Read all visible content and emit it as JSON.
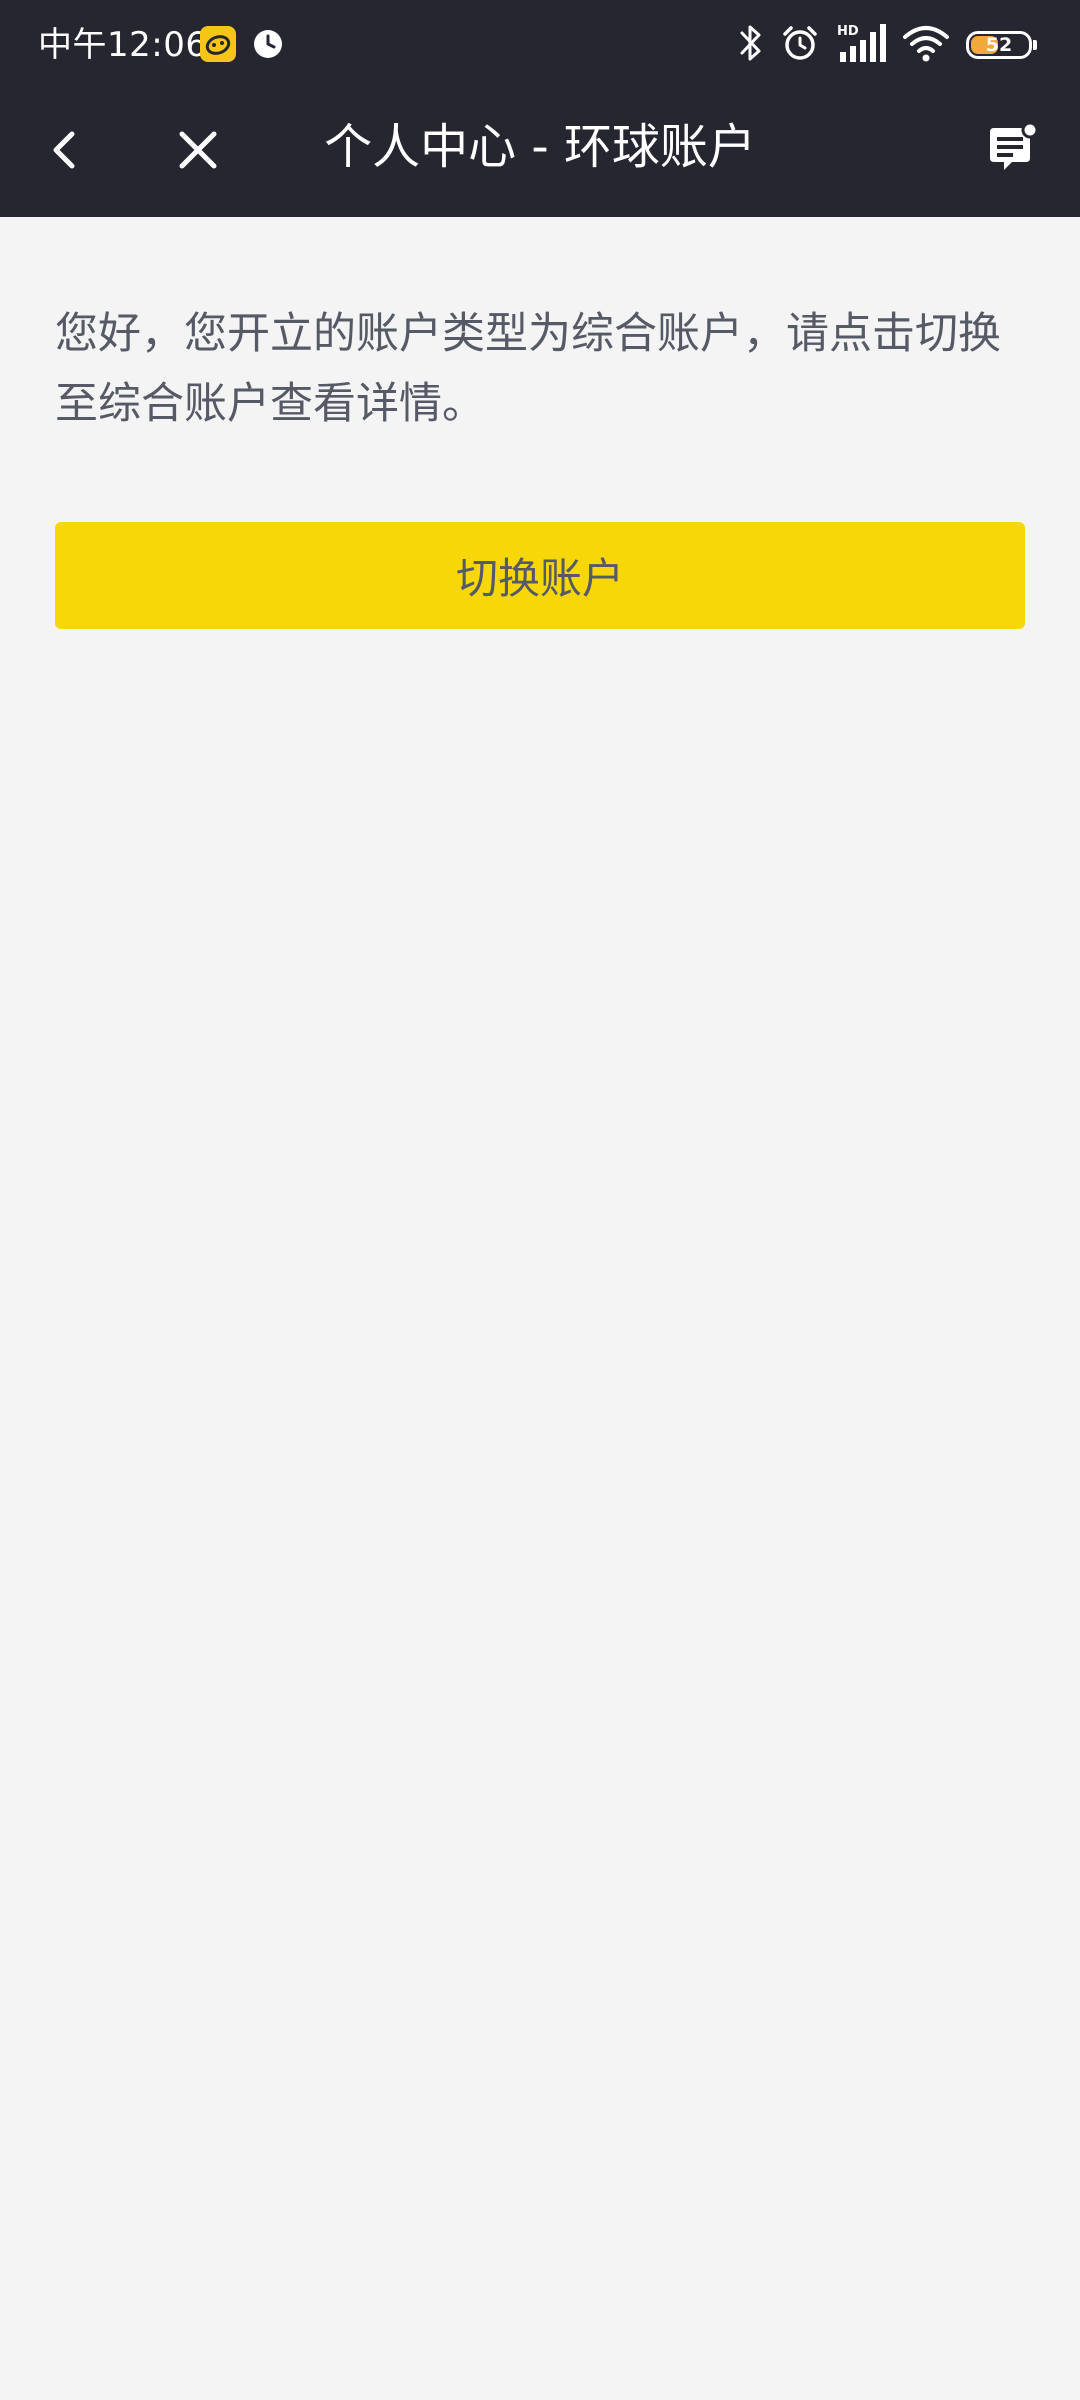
{
  "status_bar": {
    "time": "中午12:06",
    "battery_level": "52",
    "battery_percent": 52,
    "app_icon": "yellow-app-notification-icon",
    "clock_icon": "clock-notification-icon",
    "right_icons": [
      "bluetooth-icon",
      "alarm-icon",
      "hd-signal-icon",
      "wifi-icon",
      "battery-icon"
    ]
  },
  "nav": {
    "title": "个人中心 - 环球账户",
    "back_icon": "chevron-left-icon",
    "close_icon": "close-icon",
    "message_icon": "message-icon"
  },
  "content": {
    "notice": "您好，您开立的账户类型为综合账户，请点击切换至综合账户查看详情。",
    "switch_button_label": "切换账户"
  },
  "colors": {
    "header_bg": "#262630",
    "page_bg": "#f4f4f4",
    "accent_yellow": "#f7d708",
    "text_gray": "#555a66",
    "battery_fill": "#f0a93a"
  }
}
